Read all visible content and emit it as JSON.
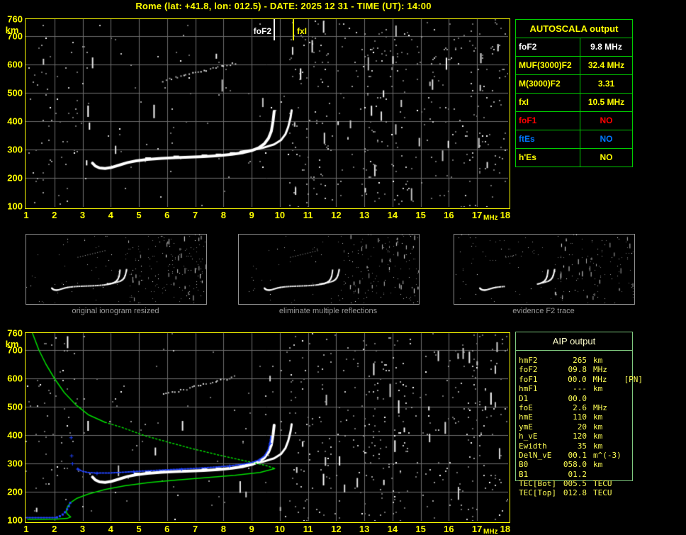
{
  "header": {
    "title": "Rome (lat: +41.8, lon: 012.5) - DATE: 2025 12 31 - TIME (UT): 14:00"
  },
  "autoscala": {
    "title": "AUTOSCALA output",
    "rows": [
      {
        "label": "foF2",
        "value": "9.8 MHz",
        "color": "#ffffff"
      },
      {
        "label": "MUF(3000)F2",
        "value": "32.4 MHz",
        "color": "#ffff00"
      },
      {
        "label": "M(3000)F2",
        "value": "3.31",
        "color": "#ffff00"
      },
      {
        "label": "fxI",
        "value": "10.5 MHz",
        "color": "#ffff00"
      },
      {
        "label": "foF1",
        "value": "NO",
        "color": "#ff0000"
      },
      {
        "label": "ftEs",
        "value": "NO",
        "color": "#0077ff"
      },
      {
        "label": "h'Es",
        "value": "NO",
        "color": "#ffff00"
      }
    ]
  },
  "aip": {
    "title": "AIP output",
    "rows": [
      {
        "label": "hmF2",
        "value": "265",
        "unit": "km",
        "extra": ""
      },
      {
        "label": "foF2",
        "value": "09.8",
        "unit": "MHz",
        "extra": ""
      },
      {
        "label": "foF1",
        "value": "00.0",
        "unit": "MHz",
        "extra": "[PN]"
      },
      {
        "label": "hmF1",
        "value": "---",
        "unit": "km",
        "extra": ""
      },
      {
        "label": "D1",
        "value": "00.0",
        "unit": "",
        "extra": ""
      },
      {
        "label": "foE",
        "value": "2.6",
        "unit": "MHz",
        "extra": ""
      },
      {
        "label": "hmE",
        "value": "110",
        "unit": "km",
        "extra": ""
      },
      {
        "label": "ymE",
        "value": "20",
        "unit": "km",
        "extra": ""
      },
      {
        "label": "h_vE",
        "value": "120",
        "unit": "km",
        "extra": ""
      },
      {
        "label": "Ewidth",
        "value": "35",
        "unit": "km",
        "extra": ""
      },
      {
        "label": "DelN_vE",
        "value": "00.1",
        "unit": "m^(-3)",
        "extra": ""
      },
      {
        "label": "B0",
        "value": "058.0",
        "unit": "km",
        "extra": ""
      },
      {
        "label": "B1",
        "value": "01.2",
        "unit": "",
        "extra": ""
      },
      {
        "label": "TEC[Bot]",
        "value": "005.5",
        "unit": "TECU",
        "extra": ""
      },
      {
        "label": "TEC[Top]",
        "value": "012.8",
        "unit": "TECU",
        "extra": ""
      }
    ]
  },
  "thumbnails": {
    "captions": [
      "original ionogram resized",
      "eliminate multiple reflections",
      "evidence F2 trace"
    ],
    "panels": [
      {
        "left_density": 0.015,
        "right_density": 0.055,
        "trace": "full",
        "seed": 101
      },
      {
        "left_density": 0.01,
        "right_density": 0.05,
        "trace": "full",
        "seed": 202
      },
      {
        "left_density": 0.013,
        "right_density": 0.03,
        "trace": "partial",
        "seed": 303
      }
    ]
  },
  "colors": {
    "yellow": "#ffff00",
    "white": "#ffffff",
    "red": "#ff0000",
    "trace_blue": "#2244ff",
    "es_blue": "#0077ff",
    "green": "#00dd00",
    "table_green": "#00cc00",
    "aip_green": "#7ec87e",
    "grid": "#6e6e6e",
    "caption_gray": "#9a9a9a",
    "aip_text": "#ffff55",
    "aip_header": "#ffffcc"
  },
  "chart_data": [
    {
      "id": "main_ionogram",
      "type": "scatter",
      "xlabel": "MHz",
      "ylabel": "km",
      "xlim": [
        1,
        18
      ],
      "ylim": [
        100,
        760
      ],
      "x_ticks": [
        1,
        2,
        3,
        4,
        5,
        6,
        7,
        8,
        9,
        10,
        11,
        12,
        13,
        14,
        15,
        16,
        17,
        18
      ],
      "y_ticks": [
        760,
        700,
        600,
        500,
        400,
        300,
        200,
        100
      ],
      "grid": true,
      "markers": {
        "foF2": {
          "f": 9.8,
          "label": "foF2"
        },
        "fxI": {
          "f": 10.5,
          "label": "fxI"
        }
      },
      "traces": {
        "o_mode": [
          [
            3.35,
            252
          ],
          [
            3.45,
            242
          ],
          [
            3.6,
            235
          ],
          [
            3.8,
            233
          ],
          [
            4.0,
            236
          ],
          [
            4.3,
            245
          ],
          [
            4.6,
            254
          ],
          [
            4.9,
            260
          ],
          [
            5.3,
            265
          ],
          [
            5.8,
            269
          ],
          [
            6.3,
            271
          ],
          [
            6.8,
            273
          ],
          [
            7.3,
            275
          ],
          [
            7.8,
            278
          ],
          [
            8.3,
            283
          ],
          [
            8.7,
            289
          ],
          [
            9.0,
            296
          ],
          [
            9.25,
            306
          ],
          [
            9.45,
            320
          ],
          [
            9.6,
            340
          ],
          [
            9.7,
            365
          ],
          [
            9.76,
            400
          ],
          [
            9.8,
            435
          ]
        ],
        "x_mode": [
          [
            8.6,
            292
          ],
          [
            9.0,
            298
          ],
          [
            9.4,
            306
          ],
          [
            9.8,
            318
          ],
          [
            10.05,
            334
          ],
          [
            10.2,
            354
          ],
          [
            10.3,
            380
          ],
          [
            10.38,
            412
          ],
          [
            10.42,
            438
          ]
        ],
        "second_hop": [
          [
            5.85,
            545
          ],
          [
            8.4,
            608
          ]
        ],
        "interference": [
          [
            3.17,
            455,
            415
          ],
          [
            3.22,
            395,
            370
          ],
          [
            3.12,
            262,
            244
          ]
        ]
      },
      "noise_bands": [
        [
          1,
          3.1,
          0.01
        ],
        [
          3.1,
          10.3,
          0.0035
        ],
        [
          10.3,
          11.8,
          0.02
        ],
        [
          11.8,
          12.9,
          0.011
        ],
        [
          12.9,
          14.6,
          0.024
        ],
        [
          14.6,
          15.9,
          0.013
        ],
        [
          15.9,
          17.3,
          0.02
        ],
        [
          17.3,
          18,
          0.015
        ]
      ]
    },
    {
      "id": "profile_ionogram",
      "type": "scatter",
      "xlabel": "MHz",
      "ylabel": "km",
      "xlim": [
        1,
        18
      ],
      "ylim": [
        100,
        760
      ],
      "x_ticks": [
        1,
        2,
        3,
        4,
        5,
        6,
        7,
        8,
        9,
        10,
        11,
        12,
        13,
        14,
        15,
        16,
        17,
        18
      ],
      "y_ticks": [
        760,
        700,
        600,
        500,
        400,
        300,
        200,
        100
      ],
      "grid": true,
      "traces": {
        "o_mode": [
          [
            3.35,
            252
          ],
          [
            3.45,
            242
          ],
          [
            3.6,
            235
          ],
          [
            3.8,
            233
          ],
          [
            4.0,
            236
          ],
          [
            4.3,
            245
          ],
          [
            4.6,
            254
          ],
          [
            4.9,
            260
          ],
          [
            5.3,
            265
          ],
          [
            5.8,
            269
          ],
          [
            6.3,
            271
          ],
          [
            6.8,
            273
          ],
          [
            7.3,
            275
          ],
          [
            7.8,
            278
          ],
          [
            8.3,
            283
          ],
          [
            8.7,
            289
          ],
          [
            9.0,
            296
          ],
          [
            9.25,
            306
          ],
          [
            9.45,
            320
          ],
          [
            9.6,
            340
          ],
          [
            9.7,
            365
          ],
          [
            9.76,
            400
          ],
          [
            9.8,
            435
          ]
        ],
        "x_mode": [
          [
            8.6,
            292
          ],
          [
            9.0,
            298
          ],
          [
            9.4,
            306
          ],
          [
            9.8,
            318
          ],
          [
            10.05,
            334
          ],
          [
            10.2,
            354
          ],
          [
            10.3,
            380
          ],
          [
            10.38,
            412
          ],
          [
            10.42,
            438
          ]
        ],
        "second_hop": [
          [
            5.85,
            545
          ],
          [
            8.4,
            608
          ]
        ],
        "interference": [
          [
            3.17,
            450,
            415
          ]
        ]
      },
      "profile": {
        "topside": [
          [
            1.22,
            760
          ],
          [
            1.45,
            700
          ],
          [
            1.7,
            650
          ],
          [
            2.0,
            600
          ],
          [
            2.35,
            550
          ],
          [
            2.75,
            508
          ],
          [
            3.2,
            472
          ],
          [
            3.8,
            445
          ],
          [
            4.4,
            427
          ],
          [
            5.2,
            398
          ],
          [
            6.0,
            376
          ],
          [
            6.9,
            352
          ],
          [
            7.9,
            328
          ],
          [
            8.9,
            306
          ],
          [
            9.5,
            293
          ],
          [
            9.82,
            282
          ]
        ],
        "bottomside": [
          [
            9.82,
            282
          ],
          [
            9.3,
            268
          ],
          [
            8.4,
            258
          ],
          [
            7.4,
            250
          ],
          [
            6.4,
            242
          ],
          [
            5.4,
            233
          ],
          [
            4.5,
            221
          ],
          [
            3.8,
            208
          ],
          [
            3.2,
            192
          ],
          [
            2.8,
            177
          ],
          [
            2.58,
            162
          ],
          [
            2.47,
            148
          ],
          [
            2.42,
            133
          ],
          [
            2.44,
            124
          ],
          [
            2.52,
            116
          ],
          [
            2.58,
            111
          ],
          [
            2.45,
            106
          ],
          [
            2.1,
            104
          ],
          [
            1.6,
            103
          ],
          [
            1.05,
            103
          ]
        ]
      },
      "restored": {
        "e_region": [
          [
            1.0,
            109
          ],
          [
            2.05,
            109
          ]
        ],
        "e_rise": [
          [
            2.08,
            111
          ],
          [
            2.18,
            115
          ],
          [
            2.28,
            121
          ],
          [
            2.36,
            129
          ],
          [
            2.44,
            139
          ],
          [
            2.5,
            150
          ],
          [
            2.55,
            162
          ]
        ],
        "spike": [
          [
            2.58,
            392
          ],
          [
            2.6,
            328
          ],
          [
            2.63,
            300
          ]
        ],
        "f_region": [
          [
            2.82,
            281
          ],
          [
            3.0,
            272
          ],
          [
            3.2,
            268
          ],
          [
            3.5,
            266
          ],
          [
            3.9,
            266
          ],
          [
            4.3,
            268
          ],
          [
            4.8,
            271
          ],
          [
            5.3,
            274
          ],
          [
            5.9,
            277
          ],
          [
            6.5,
            280
          ],
          [
            7.1,
            283
          ],
          [
            7.7,
            287
          ],
          [
            8.2,
            291
          ],
          [
            8.6,
            296
          ],
          [
            9.0,
            303
          ],
          [
            9.25,
            312
          ],
          [
            9.45,
            326
          ],
          [
            9.58,
            347
          ],
          [
            9.65,
            372
          ],
          [
            9.68,
            395
          ]
        ]
      },
      "noise_bands": [
        [
          1,
          3.1,
          0.01
        ],
        [
          3.1,
          10.3,
          0.0035
        ],
        [
          10.3,
          11.8,
          0.02
        ],
        [
          11.8,
          12.9,
          0.011
        ],
        [
          12.9,
          14.6,
          0.024
        ],
        [
          14.6,
          15.9,
          0.013
        ],
        [
          15.9,
          17.3,
          0.02
        ],
        [
          17.3,
          18,
          0.015
        ]
      ]
    }
  ]
}
